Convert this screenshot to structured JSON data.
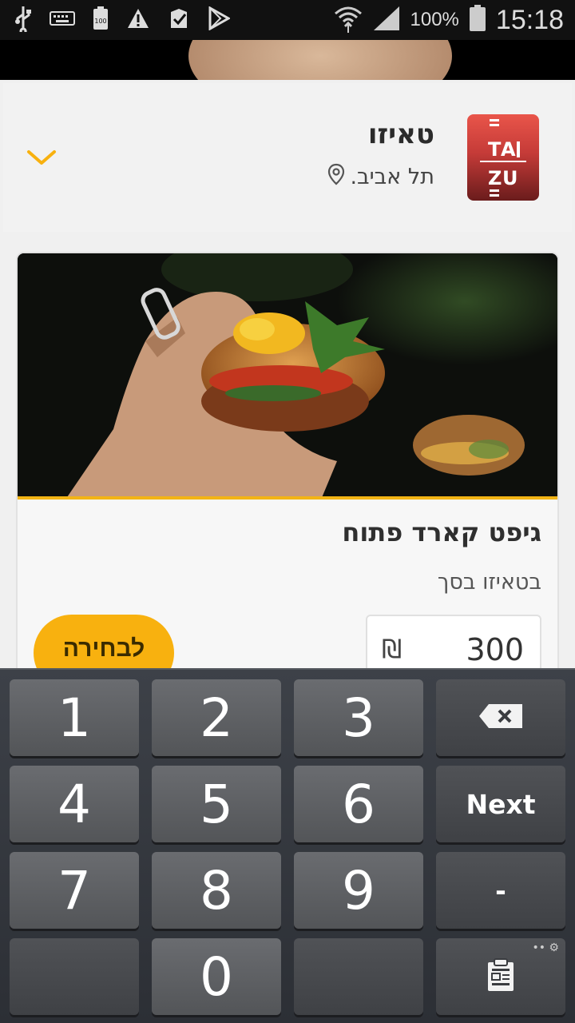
{
  "status_bar": {
    "battery_text": "100%",
    "time": "15:18"
  },
  "restaurant": {
    "name": "טאיזו",
    "location": "תל אביב.",
    "logo_text": "TAIZU"
  },
  "card": {
    "title": "גיפט קארד פתוח",
    "subtitle": "בטאיזו בסך",
    "amount": "300",
    "currency": "₪",
    "select_label": "לבחירה"
  },
  "keyboard": {
    "keys": [
      "1",
      "2",
      "3",
      "4",
      "5",
      "6",
      "7",
      "8",
      "9",
      "0"
    ],
    "next_label": "Next",
    "dash_label": "-"
  },
  "colors": {
    "accent": "#f8b10f",
    "header_bg": "#f2f2f2"
  }
}
